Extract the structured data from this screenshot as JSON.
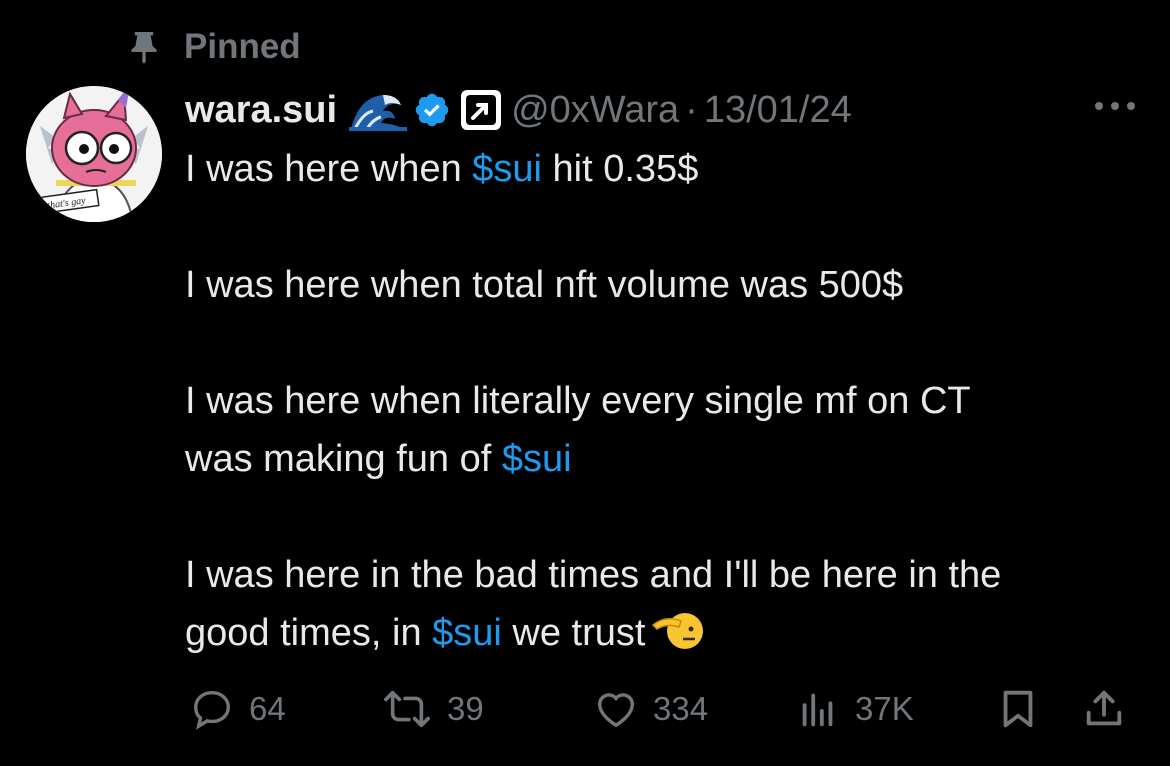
{
  "pinned": {
    "label": "Pinned",
    "icon": "pin-icon"
  },
  "author": {
    "display_name": "wara.sui",
    "handle": "@0xWara",
    "separator": "·",
    "date": "13/01/24",
    "avatar_caption": "that's gay",
    "badges": [
      "wave-emoji",
      "verified-icon",
      "affiliate-badge-icon"
    ]
  },
  "tweet": {
    "line1_pre": "I was here when ",
    "line1_mention": "$sui",
    "line1_post": " hit 0.35$",
    "line2": "I was here when total nft volume was 500$",
    "line3a": "I was here when literally every single mf on CT",
    "line3b_pre": "was making fun of ",
    "line3b_mention": "$sui",
    "line4a": "I was here in the bad times and I'll be here in the",
    "line4b_pre": "good times, in ",
    "line4b_mention": "$sui",
    "line4b_post": " we trust",
    "end_emoji": "salute-emoji"
  },
  "actions": {
    "replies": "64",
    "reposts": "39",
    "likes": "334",
    "views": "37K"
  },
  "colors": {
    "accent": "#1d9bf0",
    "muted": "#71767b",
    "text": "#e7e9ea",
    "background": "#000000"
  }
}
